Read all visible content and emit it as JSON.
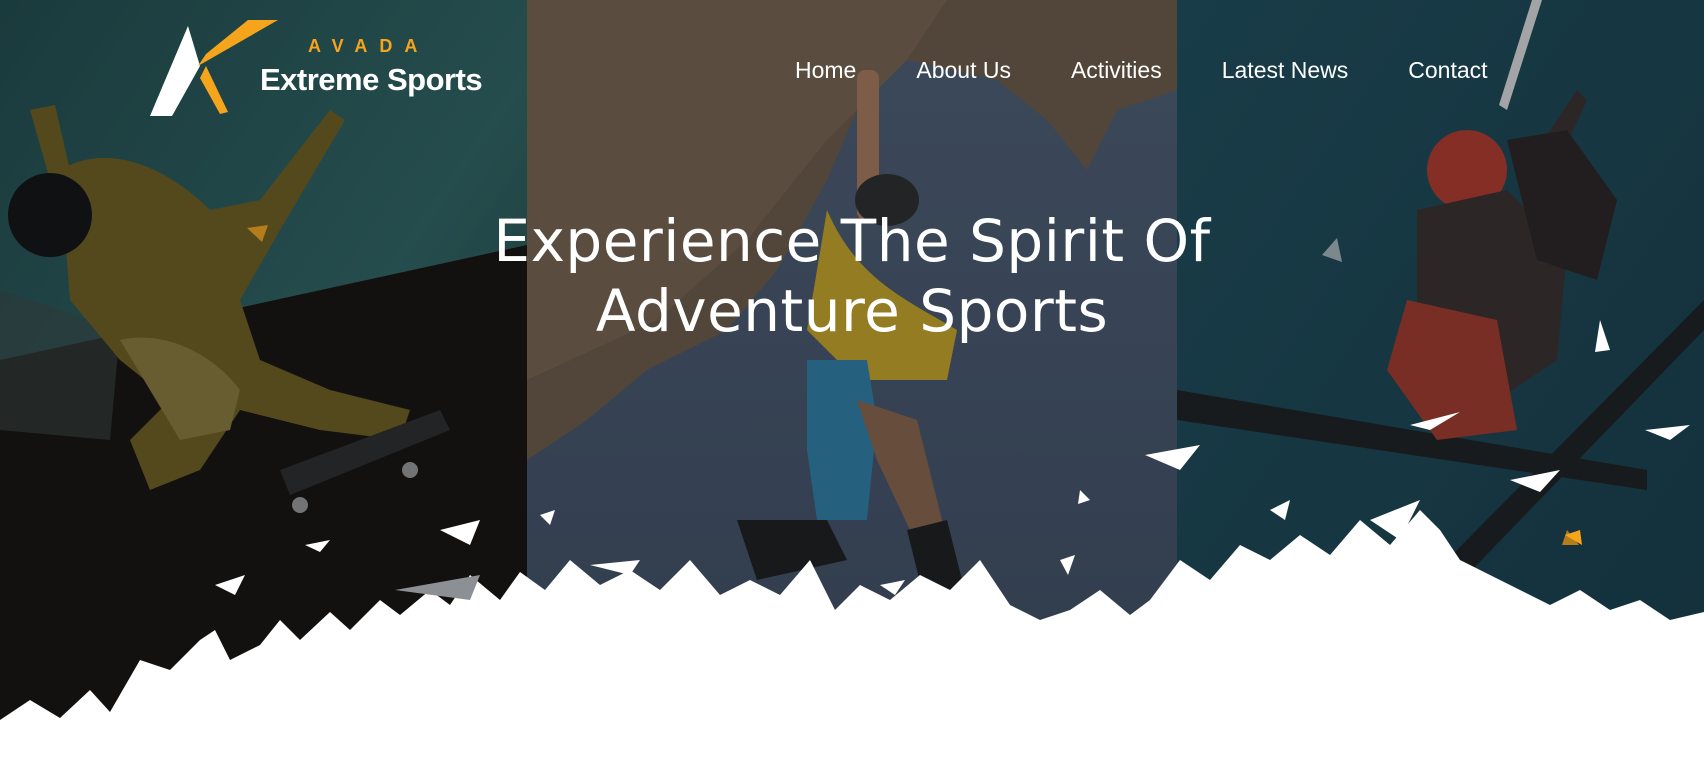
{
  "brand": {
    "small": "AVADA",
    "name": "Extreme Sports",
    "accent_color": "#f4a51c"
  },
  "nav": {
    "items": [
      {
        "label": "Home"
      },
      {
        "label": "About Us"
      },
      {
        "label": "Activities"
      },
      {
        "label": "Latest News"
      },
      {
        "label": "Contact"
      }
    ]
  },
  "hero": {
    "title_line_1": "Experience The Spirit Of",
    "title_line_2": "Adventure Sports",
    "images": [
      {
        "name": "skateboarder-photo"
      },
      {
        "name": "rock-climber-photo"
      },
      {
        "name": "skier-photo"
      }
    ]
  }
}
